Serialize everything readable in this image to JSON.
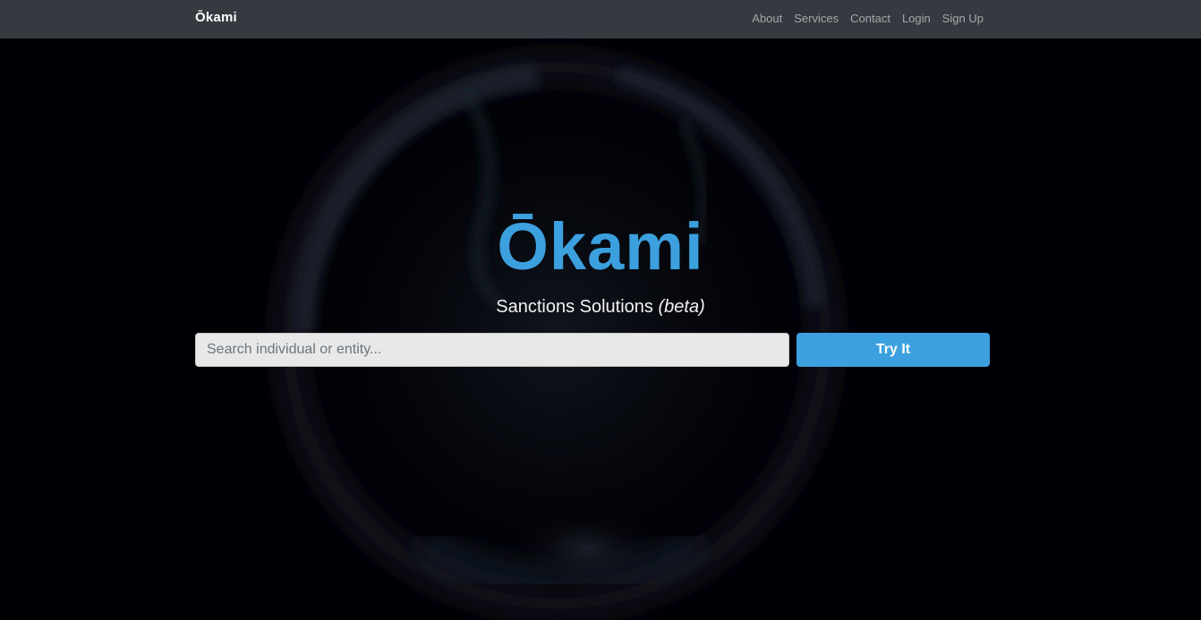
{
  "navbar": {
    "brand": "Ōkami",
    "links": [
      "About",
      "Services",
      "Contact",
      "Login",
      "Sign Up"
    ]
  },
  "hero": {
    "logo_text": "Ōkami",
    "tagline": "Sanctions Solutions",
    "tagline_suffix": "(beta)",
    "search": {
      "placeholder": "Search individual or entity...",
      "value": ""
    },
    "button_label": "Try It"
  },
  "colors": {
    "navbar_bg": "#343a40",
    "accent": "#3ca0df",
    "page_bg": "#000004"
  },
  "icons": {
    "background": "particle-globe-image"
  }
}
